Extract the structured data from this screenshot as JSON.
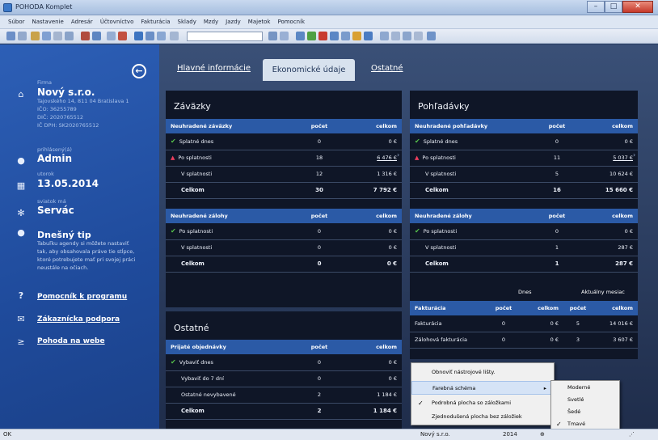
{
  "window": {
    "title": "POHODA Komplet"
  },
  "menu": [
    "Súbor",
    "Nastavenie",
    "Adresár",
    "Účtovníctvo",
    "Fakturácia",
    "Sklady",
    "Mzdy",
    "Jazdy",
    "Majetok",
    "Pomocník"
  ],
  "sidebar": {
    "firm_label": "Firma",
    "firm_name": "Nový s.r.o.",
    "firm_address": "Tajovského 14, 811 04 Bratislava 1",
    "ico": "IČO: 36255789",
    "dic": "DIČ: 2020765512",
    "icdph": "IČ DPH: SK2020765512",
    "user_label": "prihlásený(á)",
    "user": "Admin",
    "day_label": "utorok",
    "date": "13.05.2014",
    "nameday_label": "sviatok má",
    "nameday": "Servác",
    "tip_title": "Dnešný tip",
    "tip_lines": [
      "Tabuľku agendy si môžete nastaviť",
      "tak, aby obsahovala práve tie stĺpce,",
      "ktoré potrebujete mať pri svojej práci",
      "neustále na očiach."
    ],
    "links": [
      "Pomocník k programu",
      "Zákaznícka podpora",
      "Pohoda na webe"
    ]
  },
  "tabs": {
    "main": "Hlavné informácie",
    "econ": "Ekonomické údaje",
    "other": "Ostatné"
  },
  "zavazky": {
    "title": "Záväzky",
    "t1": {
      "headers": [
        "Neuhradené záväzky",
        "počet",
        "celkom"
      ],
      "rows": [
        [
          "Splatné dnes",
          "0",
          "0 €"
        ],
        [
          "Po splatnosti",
          "18",
          "6 476 €"
        ],
        [
          "V splatnosti",
          "12",
          "1 316 €"
        ],
        [
          "Celkom",
          "30",
          "7 792 €"
        ]
      ]
    },
    "t2": {
      "headers": [
        "Neuhradené zálohy",
        "počet",
        "celkom"
      ],
      "rows": [
        [
          "Po splatnosti",
          "0",
          "0 €"
        ],
        [
          "V splatnosti",
          "0",
          "0 €"
        ],
        [
          "Celkom",
          "0",
          "0 €"
        ]
      ]
    }
  },
  "pohladavky": {
    "title": "Pohľadávky",
    "t1": {
      "headers": [
        "Neuhradené pohľadávky",
        "počet",
        "celkom"
      ],
      "rows": [
        [
          "Splatné dnes",
          "0",
          "0 €"
        ],
        [
          "Po splatnosti",
          "11",
          "5 037 €"
        ],
        [
          "V splatnosti",
          "5",
          "10 624 €"
        ],
        [
          "Celkom",
          "16",
          "15 660 €"
        ]
      ]
    },
    "t2": {
      "headers": [
        "Neuhradené zálohy",
        "počet",
        "celkom"
      ],
      "rows": [
        [
          "Po splatnosti",
          "0",
          "0 €"
        ],
        [
          "V splatnosti",
          "1",
          "287 €"
        ],
        [
          "Celkom",
          "1",
          "287 €"
        ]
      ]
    },
    "fakt": {
      "today": "Dnes",
      "month": "Aktuálny mesiac",
      "headers": [
        "Fakturácia",
        "počet",
        "celkom",
        "počet",
        "celkom"
      ],
      "rows": [
        [
          "Fakturácia",
          "0",
          "0 €",
          "5",
          "14 016 €"
        ],
        [
          "Zálohová fakturácia",
          "0",
          "0 €",
          "3",
          "3 607 €"
        ]
      ]
    }
  },
  "ostatne": {
    "title": "Ostatné",
    "t": {
      "headers": [
        "Prijaté objednávky",
        "počet",
        "celkom"
      ],
      "rows": [
        [
          "Vybaviť dnes",
          "0",
          "0 €"
        ],
        [
          "Vybaviť do 7 dní",
          "0",
          "0 €"
        ],
        [
          "Ostatné nevybavené",
          "2",
          "1 184 €"
        ],
        [
          "Celkom",
          "2",
          "1 184 €"
        ]
      ]
    }
  },
  "context_menu": {
    "items": [
      "Obnoviť nástrojové lišty.",
      "Farebná schéma",
      "Podrobná plocha so záložkami",
      "Zjednodušená plocha bez záložiek"
    ],
    "submenu": [
      "Moderné",
      "Svetlé",
      "Šedé",
      "Tmavé"
    ]
  },
  "statusbar": {
    "left": "OK",
    "firm": "Nový s.r.o.",
    "year": "2014"
  },
  "colors": {
    "sidebar": "#1f4b9c",
    "header": "#2b5aa6",
    "panel": "#0f1627",
    "ok": "#56c24a",
    "warn": "#ec3e5c"
  }
}
